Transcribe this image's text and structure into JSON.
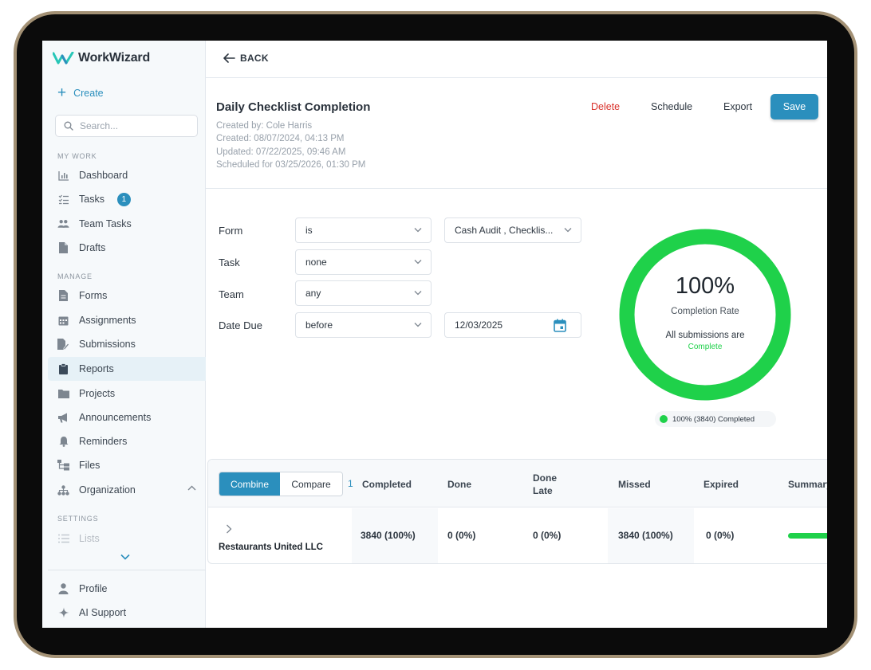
{
  "app": {
    "name": "WorkWizard"
  },
  "sidebar": {
    "create_label": "Create",
    "search_placeholder": "Search...",
    "sections": {
      "my_work": "MY WORK",
      "manage": "MANAGE",
      "settings": "SETTINGS"
    },
    "my_work_items": [
      {
        "label": "Dashboard",
        "icon": "bar-chart-icon"
      },
      {
        "label": "Tasks",
        "icon": "checklist-icon",
        "badge": "1"
      },
      {
        "label": "Team Tasks",
        "icon": "users-icon"
      },
      {
        "label": "Drafts",
        "icon": "document-icon"
      }
    ],
    "manage_items": [
      {
        "label": "Forms",
        "icon": "document-icon"
      },
      {
        "label": "Assignments",
        "icon": "calendar-icon"
      },
      {
        "label": "Submissions",
        "icon": "document-edit-icon"
      },
      {
        "label": "Reports",
        "icon": "clipboard-icon",
        "active": true
      },
      {
        "label": "Projects",
        "icon": "folder-icon"
      },
      {
        "label": "Announcements",
        "icon": "megaphone-icon"
      },
      {
        "label": "Reminders",
        "icon": "bell-icon"
      },
      {
        "label": "Files",
        "icon": "file-tree-icon"
      },
      {
        "label": "Organization",
        "icon": "org-chart-icon"
      }
    ],
    "settings_items": [
      {
        "label": "Lists",
        "icon": "list-icon"
      }
    ],
    "footer_items": [
      {
        "label": "Profile",
        "icon": "person-icon"
      },
      {
        "label": "AI Support",
        "icon": "sparkle-icon"
      }
    ]
  },
  "topbar": {
    "back_label": "BACK"
  },
  "report": {
    "title": "Daily Checklist Completion",
    "created_by": "Created by: Cole Harris",
    "created": "Created: 08/07/2024, 04:13 PM",
    "updated": "Updated: 07/22/2025, 09:46 AM",
    "scheduled": "Scheduled for 03/25/2026, 01:30 PM",
    "actions": {
      "delete": "Delete",
      "schedule": "Schedule",
      "export": "Export",
      "save": "Save"
    }
  },
  "filters": {
    "form": {
      "label": "Form",
      "operator": "is",
      "value": "Cash Audit , Checklis..."
    },
    "task": {
      "label": "Task",
      "operator": "none"
    },
    "team": {
      "label": "Team",
      "operator": "any"
    },
    "date_due": {
      "label": "Date Due",
      "operator": "before",
      "value": "12/03/2025"
    }
  },
  "completion": {
    "percent_text": "100%",
    "percent_value": 100,
    "caption": "Completion Rate",
    "note": "All submissions are",
    "status": "Complete",
    "legend": "100% (3840) Completed",
    "color": "#1fd14a"
  },
  "table": {
    "toggle": {
      "combine": "Combine",
      "compare": "Compare",
      "count": "1"
    },
    "headers": {
      "completed": "Completed",
      "done": "Done",
      "done_late_1": "Done",
      "done_late_2": "Late",
      "missed": "Missed",
      "expired": "Expired",
      "summary": "Summary"
    },
    "rows": [
      {
        "name": "Restaurants United LLC",
        "completed": "3840 (100%)",
        "done": "0 (0%)",
        "done_late": "0 (0%)",
        "missed": "3840 (100%)",
        "expired": "0 (0%)",
        "summary_fraction": 1.0
      }
    ]
  },
  "colors": {
    "accent": "#2b8fbd",
    "success": "#1fd14a",
    "danger": "#d9312b"
  }
}
